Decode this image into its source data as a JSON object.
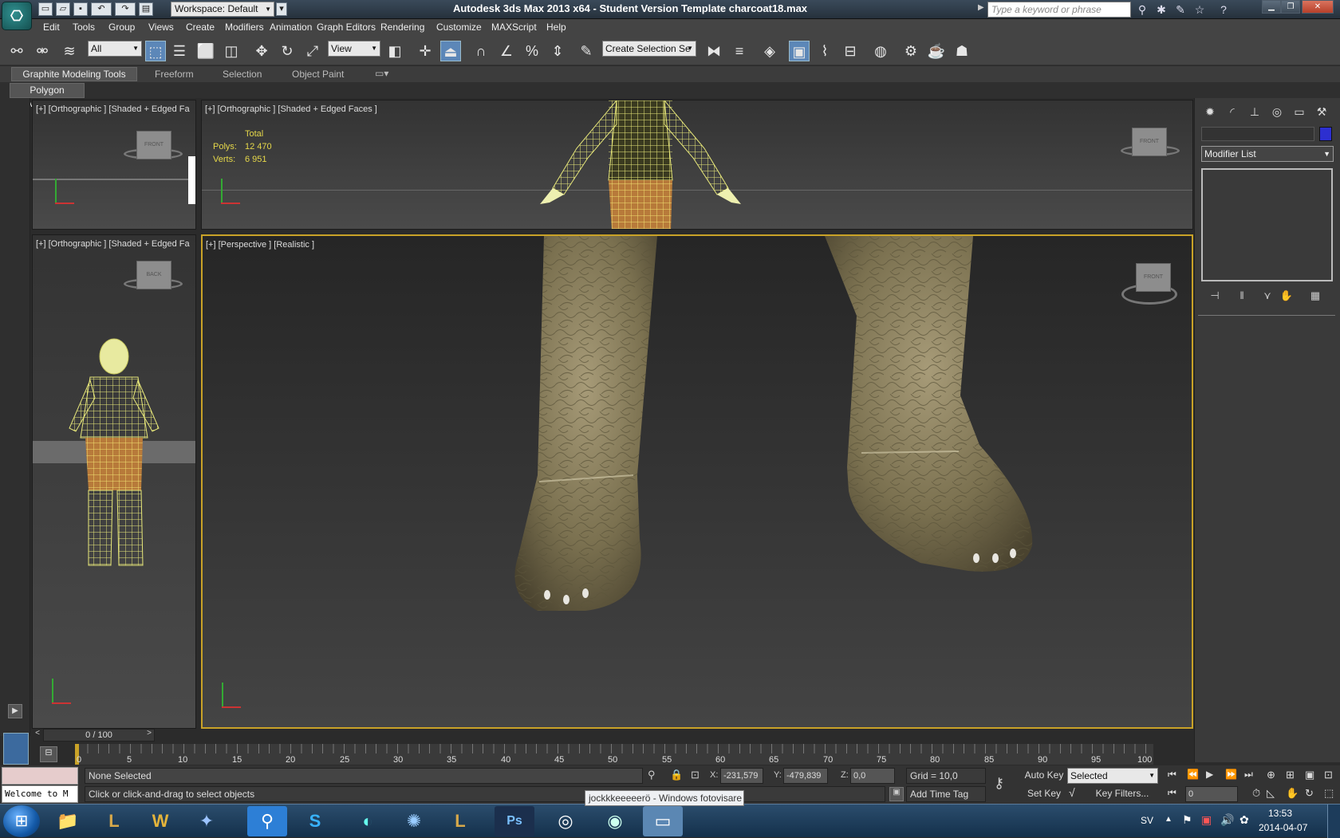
{
  "window": {
    "title": "Autodesk 3ds Max  2013 x64   - Student Version     Template charcoat18.max",
    "workspace": "Workspace: Default",
    "search_placeholder": "Type a keyword or phrase"
  },
  "menu": [
    "Edit",
    "Tools",
    "Group",
    "Views",
    "Create",
    "Modifiers",
    "Animation",
    "Graph Editors",
    "Rendering",
    "Customize",
    "MAXScript",
    "Help"
  ],
  "toolbar": {
    "filter": "All",
    "ref_coord": "View",
    "selection_set": "Create Selection Se"
  },
  "ribbon": {
    "tabs": [
      "Graphite Modeling Tools",
      "Freeform",
      "Selection",
      "Object Paint"
    ],
    "panel": "Polygon Modeling"
  },
  "viewports": {
    "top_left_label": "[+] [Orthographic ] [Shaded + Edged Fa",
    "top_main_label": "[+] [Orthographic ] [Shaded + Edged Faces ]",
    "mid_left_label": "[+] [Orthographic ] [Shaded + Edged Fa",
    "perspective_label": "[+] [Perspective ] [Realistic ]",
    "stats": {
      "header": "Total",
      "polys_label": "Polys:",
      "polys_value": "12 470",
      "verts_label": "Verts:",
      "verts_value": "6 951"
    },
    "viewcube_front": "FRONT",
    "viewcube_small_left": "FRONT",
    "viewcube_small_right": "BACK"
  },
  "command_panel": {
    "modifier_list": "Modifier List",
    "accent_color": "#2d2fd0"
  },
  "timeline": {
    "slider": "0 / 100",
    "ticks": [
      "0",
      "5",
      "10",
      "15",
      "20",
      "25",
      "30",
      "35",
      "40",
      "45",
      "50",
      "55",
      "60",
      "65",
      "70",
      "75",
      "80",
      "85",
      "90",
      "95",
      "100"
    ]
  },
  "status": {
    "welcome": "Welcome to M",
    "selection": "None Selected",
    "prompt": "Click or click-and-drag to select objects",
    "x_label": "X:",
    "x_value": "-231,579",
    "y_label": "Y:",
    "y_value": "-479,839",
    "z_label": "Z:",
    "z_value": "0,0",
    "grid": "Grid = 10,0",
    "add_time_tag": "Add Time Tag",
    "auto_key": "Auto Key",
    "set_key": "Set Key",
    "key_mode": "Selected",
    "key_filters": "Key Filters...",
    "frame": "0"
  },
  "taskbar": {
    "tooltip": "jockkkeeeeerö - Windows fotovisare",
    "lang": "SV",
    "time": "13:53",
    "date": "2014-04-07"
  }
}
